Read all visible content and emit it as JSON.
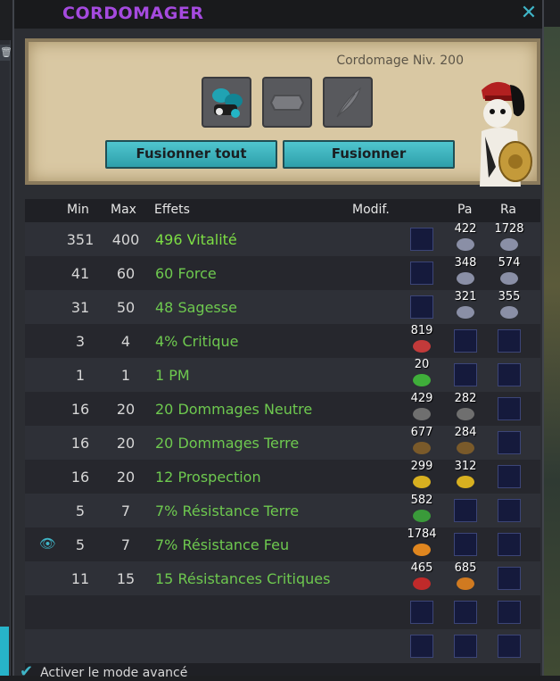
{
  "window": {
    "title": "CORDOMAGER",
    "close_icon": "close-icon"
  },
  "header": {
    "level_text": "Cordomage Niv. 200",
    "slots": [
      {
        "icon": "equipment-icon"
      },
      {
        "icon": "rune-slot-icon"
      },
      {
        "icon": "feather-icon"
      }
    ],
    "buttons": {
      "merge_all": "Fusionner tout",
      "merge": "Fusionner"
    }
  },
  "table": {
    "headers": {
      "min": "Min",
      "max": "Max",
      "effects": "Effets",
      "modif": "Modif.",
      "pa": "Pa",
      "ra": "Ra"
    },
    "rows": [
      {
        "min": "351",
        "max": "400",
        "effect": "496 Vitalité",
        "runes": [
          {
            "col": "pa",
            "count": "422",
            "color": "#8a8fa6"
          },
          {
            "col": "ra",
            "count": "1728",
            "color": "#8a8fa6"
          }
        ]
      },
      {
        "min": "41",
        "max": "60",
        "effect": "60 Force",
        "runes": [
          {
            "col": "pa",
            "count": "348",
            "color": "#8a8fa6"
          },
          {
            "col": "ra",
            "count": "574",
            "color": "#8a8fa6"
          }
        ]
      },
      {
        "min": "31",
        "max": "50",
        "effect": "48 Sagesse",
        "runes": [
          {
            "col": "pa",
            "count": "321",
            "color": "#8a8fa6"
          },
          {
            "col": "ra",
            "count": "355",
            "color": "#8a8fa6"
          }
        ]
      },
      {
        "min": "3",
        "max": "4",
        "effect": "4% Critique",
        "runes": [
          {
            "col": "modif",
            "count": "819",
            "color": "#c23a3a"
          }
        ]
      },
      {
        "min": "1",
        "max": "1",
        "effect": "1 PM",
        "runes": [
          {
            "col": "modif",
            "count": "20",
            "color": "#3fae3a"
          }
        ]
      },
      {
        "min": "16",
        "max": "20",
        "effect": "20 Dommages Neutre",
        "runes": [
          {
            "col": "modif",
            "count": "429",
            "color": "#6f6f6f"
          },
          {
            "col": "pa",
            "count": "282",
            "color": "#6f6f6f"
          }
        ]
      },
      {
        "min": "16",
        "max": "20",
        "effect": "20 Dommages Terre",
        "runes": [
          {
            "col": "modif",
            "count": "677",
            "color": "#7a5a2a"
          },
          {
            "col": "pa",
            "count": "284",
            "color": "#7a5a2a"
          }
        ]
      },
      {
        "min": "16",
        "max": "20",
        "effect": "12 Prospection",
        "runes": [
          {
            "col": "modif",
            "count": "299",
            "color": "#d8b020"
          },
          {
            "col": "pa",
            "count": "312",
            "color": "#d8b020"
          }
        ]
      },
      {
        "min": "5",
        "max": "7",
        "effect": "7% Résistance Terre",
        "runes": [
          {
            "col": "modif",
            "count": "582",
            "color": "#3a9a3a"
          }
        ]
      },
      {
        "min": "5",
        "max": "7",
        "effect": "7% Résistance Feu",
        "eye": true,
        "runes": [
          {
            "col": "modif",
            "count": "1784",
            "color": "#e0861f"
          }
        ]
      },
      {
        "min": "11",
        "max": "15",
        "effect": "15 Résistances Critiques",
        "runes": [
          {
            "col": "modif",
            "count": "465",
            "color": "#c02a2a"
          },
          {
            "col": "pa",
            "count": "685",
            "color": "#d07a20"
          }
        ]
      },
      {
        "min": "",
        "max": "",
        "effect": "",
        "runes": []
      },
      {
        "min": "",
        "max": "",
        "effect": "",
        "runes": []
      }
    ]
  },
  "footer": {
    "advanced_mode": "Activer le mode avancé"
  }
}
